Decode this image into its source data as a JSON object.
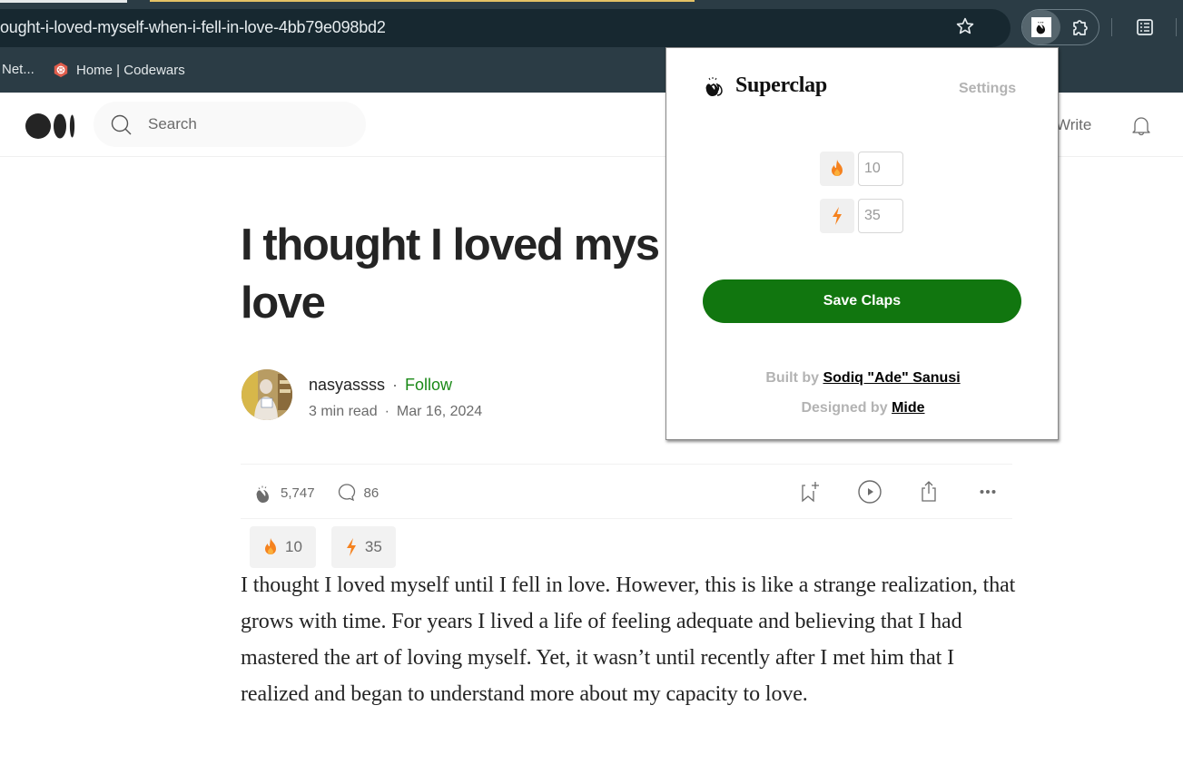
{
  "browser": {
    "url": "ought-i-loved-myself-when-i-fell-in-love-4bb79e098bd2",
    "bookmarks": [
      {
        "label": "Net..."
      },
      {
        "label": "Home | Codewars",
        "icon": "codewars-icon",
        "color": "#e05d4c"
      }
    ],
    "toolbar_icons": [
      "bookmark-star-icon",
      "superclap-extension-icon",
      "extensions-puzzle-icon",
      "reading-list-icon"
    ]
  },
  "site_header": {
    "search_placeholder": "Search",
    "write_label": "Write"
  },
  "article": {
    "title": "I thought I loved myself when I fell in love",
    "title_visible_line1": "I thought I loved mys",
    "title_visible_line2": "love",
    "author": "nasyassss",
    "follow_label": "Follow",
    "read_time": "3 min read",
    "date": "Mar 16, 2024",
    "separator": "·",
    "claps": "5,747",
    "comments": "86",
    "chips": [
      {
        "icon": "fire-icon",
        "value": "10"
      },
      {
        "icon": "lightning-icon",
        "value": "35"
      }
    ],
    "body": "I thought I loved myself until I fell in love. However, this is like a strange realization, that grows with time. For years I lived a life of feeling adequate and believing that I had mastered the art of loving myself. Yet, it wasn’t until recently after I met him that I realized and began to understand more about my capacity to love."
  },
  "popup": {
    "brand": "Superclap",
    "settings_label": "Settings",
    "fire_value": "10",
    "lightning_value": "35",
    "save_label": "Save Claps",
    "built_by_prefix": "Built by",
    "built_by_name": "Sodiq \"Ade\" Sanusi",
    "designed_by_prefix": "Designed by",
    "designed_by_name": "Mide"
  },
  "colors": {
    "accent_green": "#11760f",
    "follow_green": "#1a8917",
    "fire_orange": "#f5821f",
    "chrome_bg": "#2b3c45"
  }
}
